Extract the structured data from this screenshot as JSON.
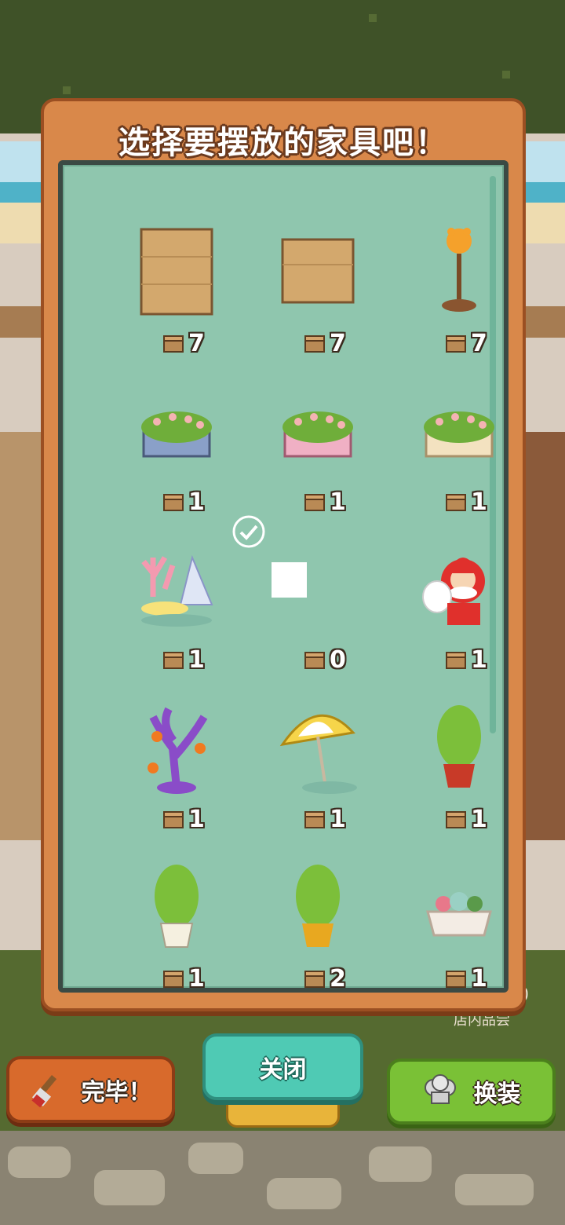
{
  "modal": {
    "title": "选择要摆放的家具吧！"
  },
  "furniture": [
    {
      "name": "cardboard-box-large-icon",
      "count": "7"
    },
    {
      "name": "cardboard-box-small-icon",
      "count": "7"
    },
    {
      "name": "bear-floor-lamp-icon",
      "count": "7"
    },
    {
      "name": "flower-planter-blue-icon",
      "count": "1"
    },
    {
      "name": "flower-planter-pink-icon",
      "count": "1"
    },
    {
      "name": "flower-planter-cream-icon",
      "count": "1"
    },
    {
      "name": "coral-seashell-decor-icon",
      "count": "1"
    },
    {
      "name": "empty-placeholder-icon",
      "count": "0"
    },
    {
      "name": "santa-claus-decor-icon",
      "count": "1"
    },
    {
      "name": "halloween-pumpkin-tree-icon",
      "count": "1"
    },
    {
      "name": "beach-umbrella-icon",
      "count": "1"
    },
    {
      "name": "potted-plant-red-pot-icon",
      "count": "1"
    },
    {
      "name": "potted-plant-white-pot-icon",
      "count": "1"
    },
    {
      "name": "potted-plant-yellow-pot-icon",
      "count": "2"
    },
    {
      "name": "succulent-planter-icon",
      "count": "1"
    }
  ],
  "buttons": {
    "done": "完毕！",
    "close": "关闭",
    "dress": "换装"
  },
  "background": {
    "sign_text": "店内品尝",
    "sign_num": "0"
  },
  "colors": {
    "panel": "#8fc6ae",
    "modal_frame": "#d9884a",
    "done_button": "#d86a2c",
    "close_button": "#4fcab4",
    "dress_button": "#7ac136"
  }
}
